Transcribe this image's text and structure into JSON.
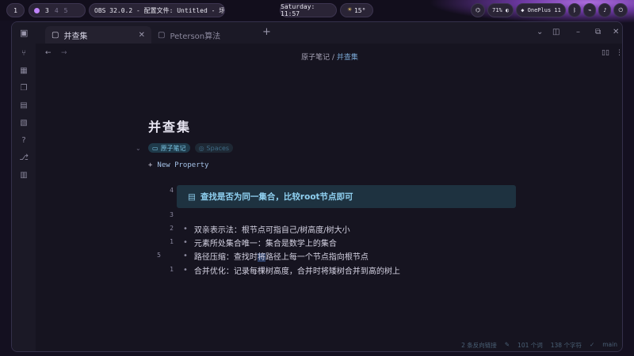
{
  "desktop": {
    "workspace_active": "1",
    "workspaces": [
      "3",
      "4",
      "5"
    ],
    "obs_text": "OBS 32.0.2 - 配置文件: Untitled - 场景: Un…",
    "clock": "Saturday: 11:57",
    "weather": "15°",
    "battery": "71%",
    "device": "OnePlus 11"
  },
  "tabs": [
    {
      "label": "并查集"
    },
    {
      "label": "Peterson算法"
    }
  ],
  "breadcrumb": {
    "parent": "原子笔记",
    "sep": "/",
    "current": "并查集"
  },
  "note": {
    "title": "并查集",
    "tags": [
      "原子笔记",
      "Spaces"
    ],
    "new_property": "New Property",
    "callout": "查找是否为同一集合，比较root节点即可",
    "line_numbers": [
      "4",
      "3",
      "2",
      "1",
      "5",
      "1"
    ],
    "items": [
      "双亲表示法：根节点可指自己/树高度/树大小",
      "元素所处集合唯一：集合是数学上的集合",
      "合并优化：记录每棵树高度，合并时将矮树合并到高的树上"
    ],
    "item3_before": "路径压缩：查找时",
    "item3_sel": "将",
    "item3_after": "路径上每一个节点指向根节点"
  },
  "statusbar": {
    "backlinks": "2 条反向链接",
    "words": "101 个词",
    "chars": "138 个字符",
    "branch": "main"
  },
  "colors": {
    "accent": "#7aa9d6",
    "callout_bg": "#1e3240",
    "callout_text": "#8fd0f0"
  }
}
